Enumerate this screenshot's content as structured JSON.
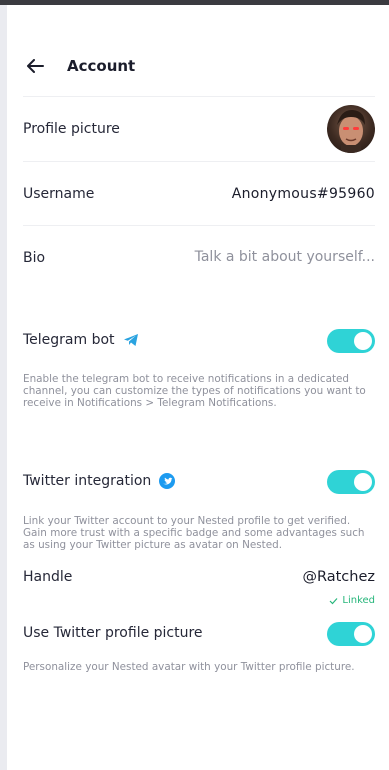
{
  "header": {
    "title": "Account",
    "back_icon": "arrow-left-icon"
  },
  "profile_picture": {
    "label": "Profile picture"
  },
  "username": {
    "label": "Username",
    "value": "Anonymous#95960"
  },
  "bio": {
    "label": "Bio",
    "placeholder": "Talk a bit about yourself...",
    "value": ""
  },
  "telegram": {
    "label": "Telegram bot",
    "icon": "telegram-icon",
    "enabled": true,
    "help": "Enable the telegram bot to receive notifications in a dedicated channel, you can customize the types of notifications you want to receive in Notifications > Telegram Notifications."
  },
  "twitter": {
    "label": "Twitter integration",
    "icon": "twitter-icon",
    "enabled": true,
    "help": "Link your Twitter account to your Nested profile to get verified. Gain more trust with a specific badge and some advantages such as using your Twitter picture as avatar on Nested.",
    "handle_label": "Handle",
    "handle_value": "@Ratchez",
    "linked_label": "Linked",
    "use_picture_label": "Use Twitter profile picture",
    "use_picture_enabled": true,
    "use_picture_help": "Personalize your Nested avatar with your Twitter profile picture."
  },
  "colors": {
    "accent": "#2fd3d6",
    "linked": "#27b67b",
    "twitter_blue": "#1d9bf0",
    "telegram_blue": "#2aa3e0",
    "muted_text": "#8f919c"
  }
}
